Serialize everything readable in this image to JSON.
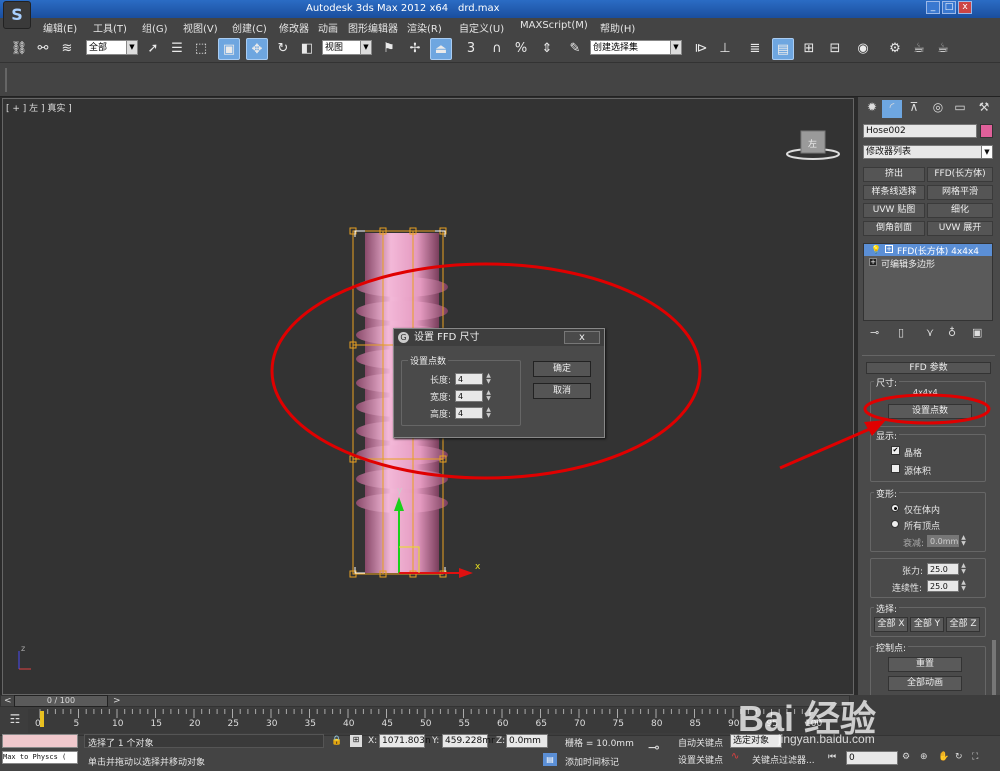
{
  "title_bar": {
    "app_title": "Autodesk 3ds Max  2012 x64",
    "filename": "drd.max",
    "min": "_",
    "restore": "□",
    "close": "x"
  },
  "menu": [
    "编辑(E)",
    "工具(T)",
    "组(G)",
    "视图(V)",
    "创建(C)",
    "修改器",
    "动画",
    "图形编辑器",
    "渲染(R)",
    "自定义(U)",
    "MAXScript(M)",
    "帮助(H)"
  ],
  "toolbar": {
    "selection_filter": "全部",
    "ref_coord": "视图",
    "named_selection": "创建选择集",
    "snap_label": "3",
    "percent_label": "%"
  },
  "viewport": {
    "label": "[ + ] 左 ] 真实 ]",
    "viewcube_label": "左",
    "axis_x": "x",
    "axis_y": "y",
    "axis_z": "z"
  },
  "dialog": {
    "title": "设置 FFD 尺寸",
    "close": "x",
    "group_label": "设置点数",
    "length_label": "长度:",
    "length_value": "4",
    "width_label": "宽度:",
    "width_value": "4",
    "height_label": "高度:",
    "height_value": "4",
    "ok": "确定",
    "cancel": "取消"
  },
  "panel": {
    "object_name": "Hose002",
    "object_color": "#e0609a",
    "modifier_list": "修改器列表",
    "mod_buttons": [
      "挤出",
      "FFD(长方体)",
      "样条线选择",
      "网格平滑",
      "UVW 贴图",
      "细化",
      "倒角剖面",
      "UVW 展开"
    ],
    "stack_items": [
      "FFD(长方体) 4x4x4",
      "可编辑多边形"
    ],
    "rollout_title": "FFD 参数",
    "dimensions_label": "尺寸:",
    "dimensions_text": "4x4x4",
    "set_points": "设置点数",
    "display_label": "显示:",
    "lattice": "晶格",
    "source_volume": "源体积",
    "deform_label": "变形:",
    "only_in_volume": "仅在体内",
    "all_vertices": "所有顶点",
    "falloff_label": "衰减:",
    "falloff_value": "0.0mm",
    "tension_label": "张力:",
    "tension_value": "25.0",
    "continuity_label": "连续性:",
    "continuity_value": "25.0",
    "select_label": "选择:",
    "all_x": "全部 X",
    "all_y": "全部 Y",
    "all_z": "全部 Z",
    "control_points_label": "控制点:",
    "reset": "重置",
    "animate_all": "全部动画"
  },
  "timeline": {
    "frame": "0 / 100",
    "ticks": [
      "0",
      "5",
      "10",
      "15",
      "20",
      "25",
      "30",
      "35",
      "40",
      "45",
      "50",
      "55",
      "60",
      "65",
      "70",
      "75",
      "80",
      "85",
      "90",
      "95",
      "100"
    ]
  },
  "status": {
    "script_listener": "Max to Physcs (",
    "selected": "选择了 1 个对象",
    "prompt": "单击并拖动以选择并移动对象",
    "x_label": "X:",
    "x_value": "1071.803n",
    "y_label": "Y:",
    "y_value": "459.228mr",
    "z_label": "Z:",
    "z_value": "0.0mm",
    "grid": "栅格 = 10.0mm",
    "add_time_tag": "添加时间标记",
    "auto_key": "自动关键点",
    "set_key": "设置关键点",
    "selected_objects": "选定对象",
    "key_filters": "关键点过滤器...",
    "current_frame": "0"
  },
  "watermark": {
    "brand": "Bai 经验",
    "url": "jingyan.baidu.com"
  }
}
